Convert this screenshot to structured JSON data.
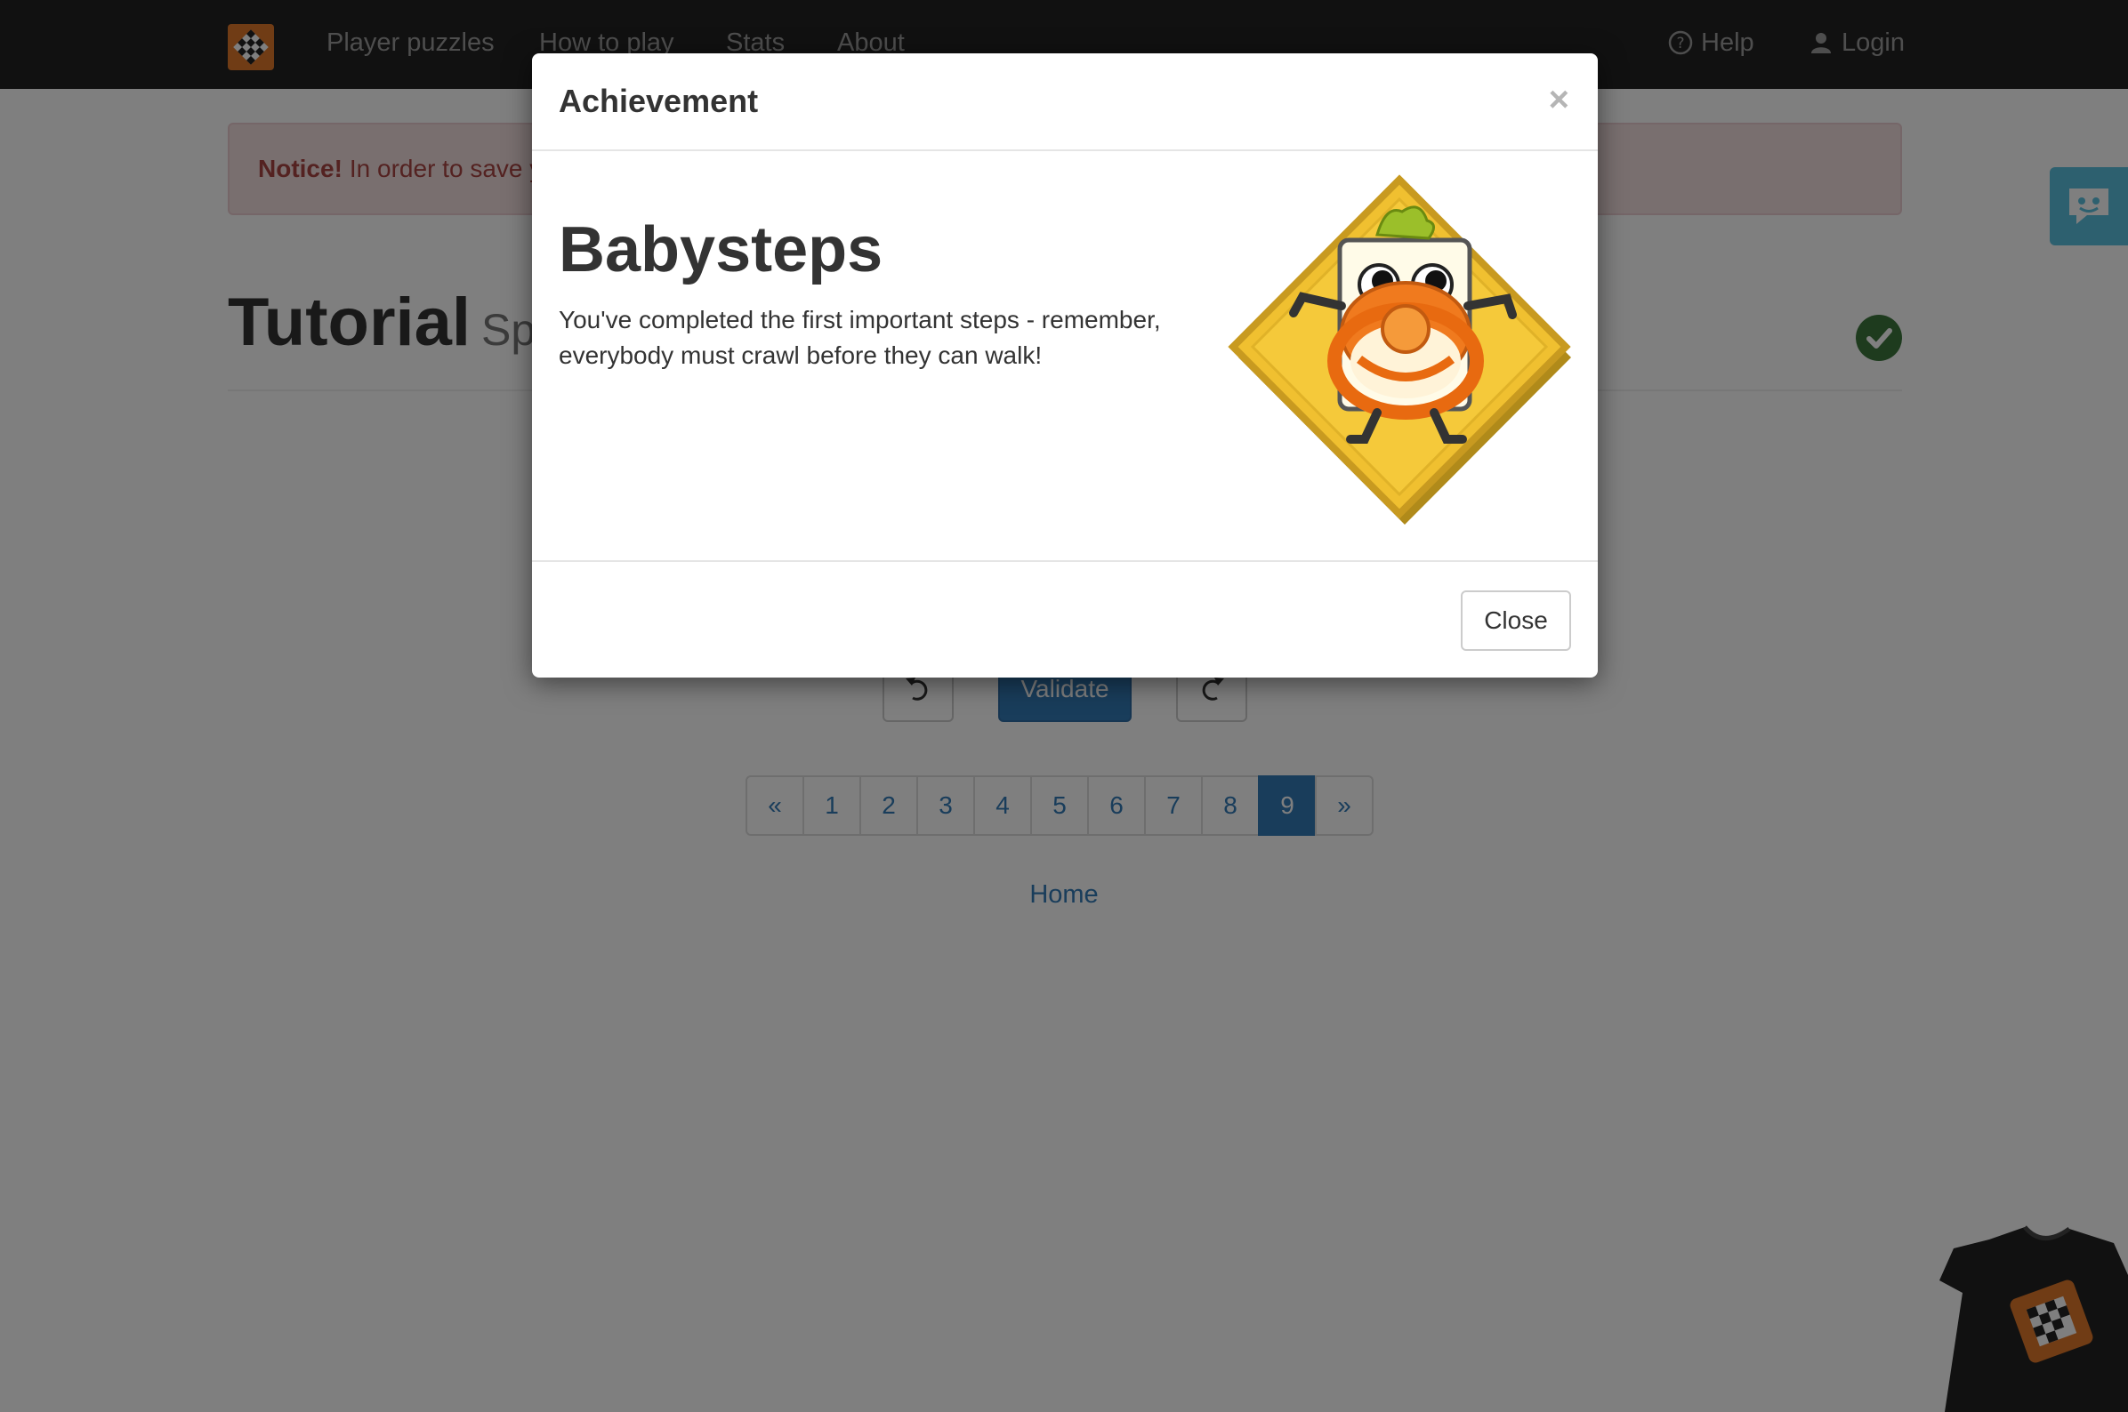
{
  "navbar": {
    "links": [
      "Player puzzles",
      "How to play",
      "Stats",
      "About"
    ],
    "help": "Help",
    "login": "Login"
  },
  "notice": {
    "label": "Notice!",
    "text": "In order to save your progress you need to login or create an account."
  },
  "page": {
    "title": "Tutorial",
    "subtitle": "Spa"
  },
  "controls": {
    "validate": "Validate"
  },
  "pagination": {
    "prev": "«",
    "pages": [
      "1",
      "2",
      "3",
      "4",
      "5",
      "6",
      "7",
      "8",
      "9"
    ],
    "next": "»",
    "active": "9"
  },
  "home_link": "Home",
  "modal": {
    "title": "Achievement",
    "close_x": "×",
    "achievement_name": "Babysteps",
    "achievement_text": "You've completed the first important steps - remember, everybody must crawl before they can walk!",
    "close_button": "Close"
  },
  "colors": {
    "navbar": "#222222",
    "primary": "#337ab7",
    "notice_bg": "#f2dede",
    "notice_text": "#a94442",
    "success": "#3c763d",
    "brand": "#e0782b",
    "chat_tab": "#5bc0de"
  }
}
